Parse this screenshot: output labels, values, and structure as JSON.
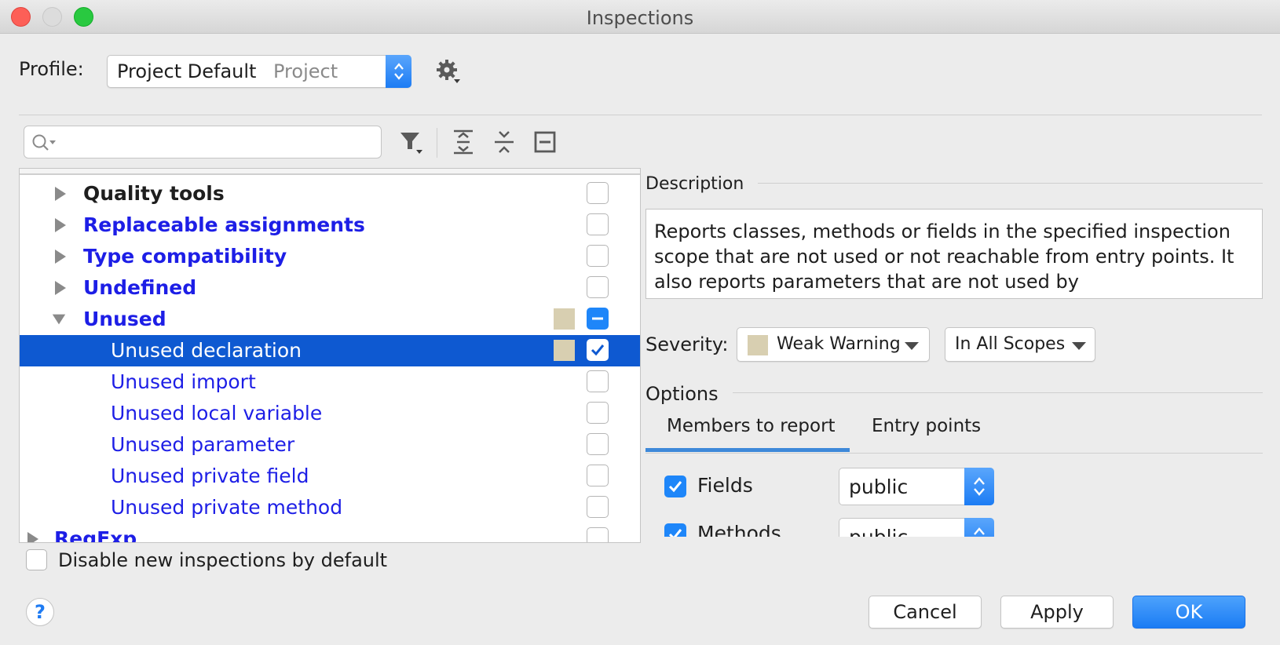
{
  "window": {
    "title": "Inspections"
  },
  "profile": {
    "label": "Profile:",
    "name": "Project Default",
    "scope": "Project"
  },
  "search": {
    "placeholder": ""
  },
  "description": {
    "title": "Description",
    "text": "Reports classes, methods or fields in the specified inspection scope that are not used or not reachable from entry points. It also reports parameters that are not used by"
  },
  "tree": {
    "rows": [
      {
        "label": "Quality tools",
        "level": 0,
        "expanded": false,
        "bold": true,
        "color": "black",
        "checked": "off",
        "swatch": false
      },
      {
        "label": "Replaceable assignments",
        "level": 0,
        "expanded": false,
        "bold": true,
        "color": "blue",
        "checked": "off",
        "swatch": false
      },
      {
        "label": "Type compatibility",
        "level": 0,
        "expanded": false,
        "bold": true,
        "color": "blue",
        "checked": "off",
        "swatch": false
      },
      {
        "label": "Undefined",
        "level": 0,
        "expanded": false,
        "bold": true,
        "color": "blue",
        "checked": "off",
        "swatch": false
      },
      {
        "label": "Unused",
        "level": 0,
        "expanded": true,
        "bold": true,
        "color": "blue",
        "checked": "mixed",
        "swatch": true
      },
      {
        "label": "Unused declaration",
        "level": 1,
        "bold": false,
        "color": "blue",
        "checked": "on",
        "swatch": true,
        "selected": true
      },
      {
        "label": "Unused import",
        "level": 1,
        "bold": false,
        "color": "blue",
        "checked": "off",
        "swatch": false
      },
      {
        "label": "Unused local variable",
        "level": 1,
        "bold": false,
        "color": "blue",
        "checked": "off",
        "swatch": false
      },
      {
        "label": "Unused parameter",
        "level": 1,
        "bold": false,
        "color": "blue",
        "checked": "off",
        "swatch": false
      },
      {
        "label": "Unused private field",
        "level": 1,
        "bold": false,
        "color": "blue",
        "checked": "off",
        "swatch": false
      },
      {
        "label": "Unused private method",
        "level": 1,
        "bold": false,
        "color": "blue",
        "checked": "off",
        "swatch": false
      },
      {
        "label": "RegExp",
        "level": -1,
        "expanded": false,
        "bold": true,
        "color": "blue",
        "checked": "off",
        "swatch": false
      }
    ]
  },
  "disable_new": {
    "label": "Disable new inspections by default",
    "checked": false
  },
  "severity": {
    "label": "Severity:",
    "value": "Weak Warning",
    "scope": "In All Scopes",
    "swatch_color": "#d8cfb1"
  },
  "options": {
    "title": "Options",
    "tabs": [
      {
        "label": "Members to report",
        "active": true
      },
      {
        "label": "Entry points",
        "active": false
      }
    ],
    "members": [
      {
        "label": "Fields",
        "checked": true,
        "visibility": "public"
      },
      {
        "label": "Methods",
        "checked": true,
        "visibility": "public"
      }
    ]
  },
  "buttons": {
    "help": "?",
    "cancel": "Cancel",
    "apply": "Apply",
    "ok": "OK"
  },
  "colors": {
    "accent": "#1e86f9",
    "selection": "#0e59d1",
    "link_blue": "#1d1ee6",
    "swatch": "#d8cfb1"
  },
  "icons": [
    "gear-icon",
    "search-icon",
    "filter-icon",
    "expand-all-icon",
    "collapse-all-icon",
    "reset-icon",
    "disclosure-triangle-icon",
    "help-icon"
  ]
}
